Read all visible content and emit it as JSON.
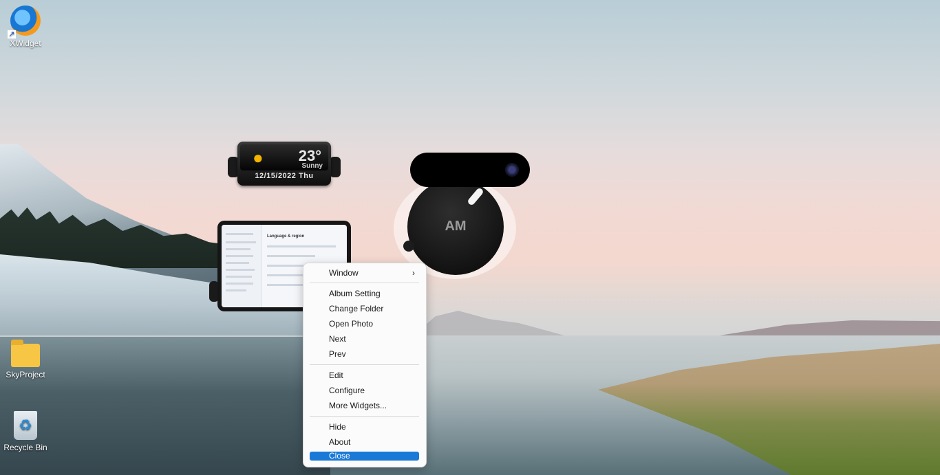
{
  "desktop": {
    "icons": [
      {
        "label": "XWidget",
        "icon": "xwidget-icon"
      },
      {
        "label": "SkyProject",
        "icon": "folder-icon"
      },
      {
        "label": "Recycle Bin",
        "icon": "recycle-bin-icon"
      }
    ]
  },
  "weather_widget": {
    "temperature": "23°",
    "condition": "Sunny",
    "date": "12/15/2022 Thu",
    "icon": "sun-icon"
  },
  "photo_widget": {
    "preview_title": "Language & region"
  },
  "clock_widget": {
    "period": "AM"
  },
  "context_menu": {
    "items": [
      {
        "label": "Window",
        "submenu": true
      },
      {
        "label": "Album Setting"
      },
      {
        "label": "Change Folder"
      },
      {
        "label": "Open Photo"
      },
      {
        "label": "Next"
      },
      {
        "label": "Prev"
      },
      {
        "label": "Edit"
      },
      {
        "label": "Configure"
      },
      {
        "label": "More Widgets..."
      },
      {
        "label": "Hide"
      },
      {
        "label": "About"
      },
      {
        "label": "Close",
        "highlighted": true
      }
    ],
    "highlight_color": "#1a79d6"
  }
}
